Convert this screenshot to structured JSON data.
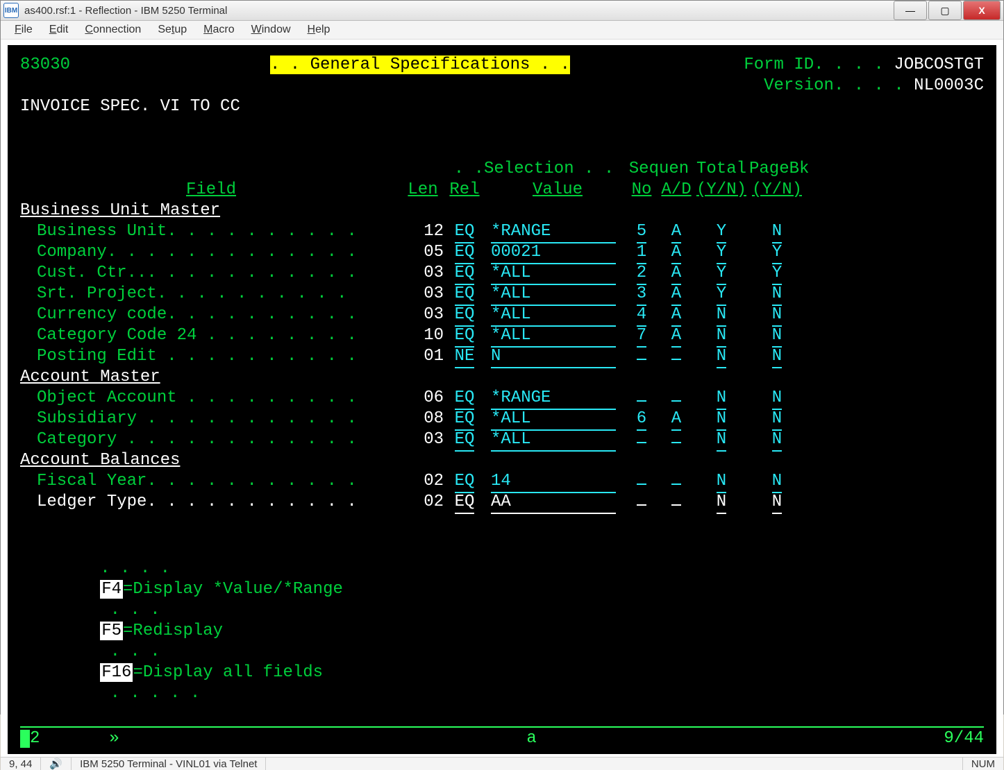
{
  "window": {
    "title": "as400.rsf:1 - Reflection - IBM 5250 Terminal"
  },
  "menu": {
    "file": "File",
    "edit": "Edit",
    "connection": "Connection",
    "setup": "Setup",
    "macro": "Macro",
    "window": "Window",
    "help": "Help"
  },
  "header": {
    "program_id": "83030",
    "title": "General Specifications",
    "form_id_label": "Form ID. . . .",
    "form_id": "JOBCOSTGT",
    "version_label": "Version. . . .",
    "version": "NL0003C",
    "subtitle": "INVOICE SPEC. VI TO CC"
  },
  "columns": {
    "pre_selection": ". .Selection . .",
    "pre_sequen": "Sequen",
    "pre_total": "Total",
    "pre_pagebk": "PageBk",
    "field": "Field",
    "len": "Len",
    "rel": "Rel",
    "value": "Value",
    "seq_no": "No",
    "ad": "A/D",
    "total": "(Y/N)",
    "pagebk": "(Y/N)"
  },
  "sections": [
    {
      "name": "Business Unit Master",
      "rows": [
        {
          "field": "Business Unit. . . . . . . . . .",
          "len": "12",
          "rel": "EQ",
          "value": "*RANGE",
          "seq": "5",
          "ad": "A",
          "tot": "Y",
          "pgb": "N",
          "style": "cyan"
        },
        {
          "field": "Company. . . . . . . . . . . . .",
          "len": "05",
          "rel": "EQ",
          "value": "00021",
          "seq": "1",
          "ad": "A",
          "tot": "Y",
          "pgb": "Y",
          "style": "cyan"
        },
        {
          "field": "Cust. Ctr... . . . . . . . . . .",
          "len": "03",
          "rel": "EQ",
          "value": "*ALL",
          "seq": "2",
          "ad": "A",
          "tot": "Y",
          "pgb": "Y",
          "style": "cyan"
        },
        {
          "field": "Srt. Project. . . . . . . . . .",
          "len": "03",
          "rel": "EQ",
          "value": "*ALL",
          "seq": "3",
          "ad": "A",
          "tot": "Y",
          "pgb": "N",
          "style": "cyan"
        },
        {
          "field": "Currency code. . . . . . . . . .",
          "len": "03",
          "rel": "EQ",
          "value": "*ALL",
          "seq": "4",
          "ad": "A",
          "tot": "N",
          "pgb": "N",
          "style": "cyan"
        },
        {
          "field": "Category Code 24 . . . . . . . .",
          "len": "10",
          "rel": "EQ",
          "value": "*ALL",
          "seq": "7",
          "ad": "A",
          "tot": "N",
          "pgb": "N",
          "style": "cyan"
        },
        {
          "field": "Posting Edit . . . . . . . . . .",
          "len": "01",
          "rel": "NE",
          "value": "N",
          "seq": " ",
          "ad": " ",
          "tot": "N",
          "pgb": "N",
          "style": "cyan"
        }
      ]
    },
    {
      "name": "Account Master",
      "rows": [
        {
          "field": "Object Account . . . . . . . . .",
          "len": "06",
          "rel": "EQ",
          "value": "*RANGE",
          "seq": " ",
          "ad": " ",
          "tot": "N",
          "pgb": "N",
          "style": "cyan"
        },
        {
          "field": "Subsidiary . . . . . . . . . . .",
          "len": "08",
          "rel": "EQ",
          "value": "*ALL",
          "seq": "6",
          "ad": "A",
          "tot": "N",
          "pgb": "N",
          "style": "cyan"
        },
        {
          "field": "Category . . . . . . . . . . . .",
          "len": "03",
          "rel": "EQ",
          "value": "*ALL",
          "seq": " ",
          "ad": " ",
          "tot": "N",
          "pgb": "N",
          "style": "cyan"
        }
      ]
    },
    {
      "name": "Account Balances",
      "rows": [
        {
          "field": "Fiscal Year. . . . . . . . . . .",
          "len": "02",
          "rel": "EQ",
          "value": "14",
          "seq": " ",
          "ad": " ",
          "tot": "N",
          "pgb": "N",
          "style": "cyan"
        },
        {
          "field": "Ledger Type. . . . . . . . . . .",
          "len": "02",
          "rel": "EQ",
          "value": "AA",
          "seq": " ",
          "ad": " ",
          "tot": "N",
          "pgb": "N",
          "style": "white"
        }
      ]
    }
  ],
  "fkeys": {
    "dots_left": ". . . .",
    "f4": "F4",
    "f4_text": "=Display *Value/*Range",
    "dots_mid1": ". . .",
    "f5": "F5",
    "f5_text": "=Redisplay",
    "dots_mid2": ". . .",
    "f16": "F16",
    "f16_text": "=Display all fields",
    "dots_right": ". . . . ."
  },
  "status": {
    "left_num": "2",
    "arrow": "»",
    "mid": "a",
    "position": "9/44"
  },
  "footer": {
    "cursor": "9, 44",
    "connection": "IBM 5250 Terminal - VINL01 via Telnet",
    "num": "NUM"
  }
}
